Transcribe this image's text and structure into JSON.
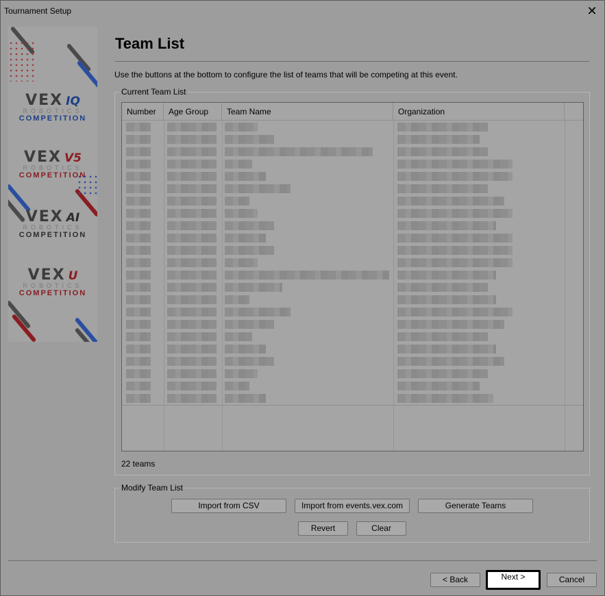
{
  "window": {
    "title": "Tournament Setup",
    "close_glyph": "✕"
  },
  "banner": {
    "logos": [
      {
        "brand": "VEX",
        "sub": "IQ",
        "robotics": "ROBOTICS",
        "competition": "COMPETITION"
      },
      {
        "brand": "VEX",
        "sub": "V5",
        "robotics": "ROBOTICS",
        "competition": "COMPETITION"
      },
      {
        "brand": "VEX",
        "sub": "AI",
        "robotics": "ROBOTICS",
        "competition": "COMPETITION"
      },
      {
        "brand": "VEX",
        "sub": "U",
        "robotics": "ROBOTICS",
        "competition": "COMPETITION"
      }
    ]
  },
  "header": {
    "title": "Team List",
    "instructions": "Use the buttons at the bottom to configure the list of teams that will be competing at this event."
  },
  "current": {
    "legend": "Current Team List",
    "columns": [
      "Number",
      "Age Group",
      "Team Name",
      "Organization"
    ],
    "count_label": "22 teams"
  },
  "modify": {
    "legend": "Modify Team List",
    "import_csv": "Import from CSV",
    "import_events": "Import from events.vex.com",
    "generate": "Generate Teams",
    "revert": "Revert",
    "clear": "Clear"
  },
  "nav": {
    "back": "< Back",
    "next": "Next >",
    "cancel": "Cancel"
  },
  "colors": {
    "background": "#9d9d9d",
    "iq_blue": "#1c3f86",
    "v5_red": "#8a1d22"
  }
}
